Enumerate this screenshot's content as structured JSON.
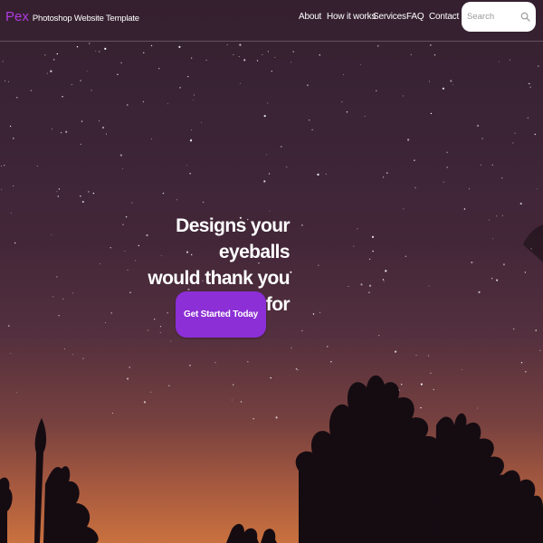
{
  "brand": {
    "name": "Pex",
    "tagline": "Photoshop Website Template"
  },
  "nav": {
    "links": [
      "About",
      "How it works",
      "Services",
      "FAQ",
      "Contact"
    ]
  },
  "search": {
    "placeholder": "Search",
    "value": ""
  },
  "hero": {
    "headline_line1": "Designs your eyeballs",
    "headline_line2": "would thank you for",
    "cta_label": "Get Started Today"
  },
  "colors": {
    "accent": "#8c2fd6",
    "brand": "#b13be0",
    "text": "#ffffff"
  }
}
